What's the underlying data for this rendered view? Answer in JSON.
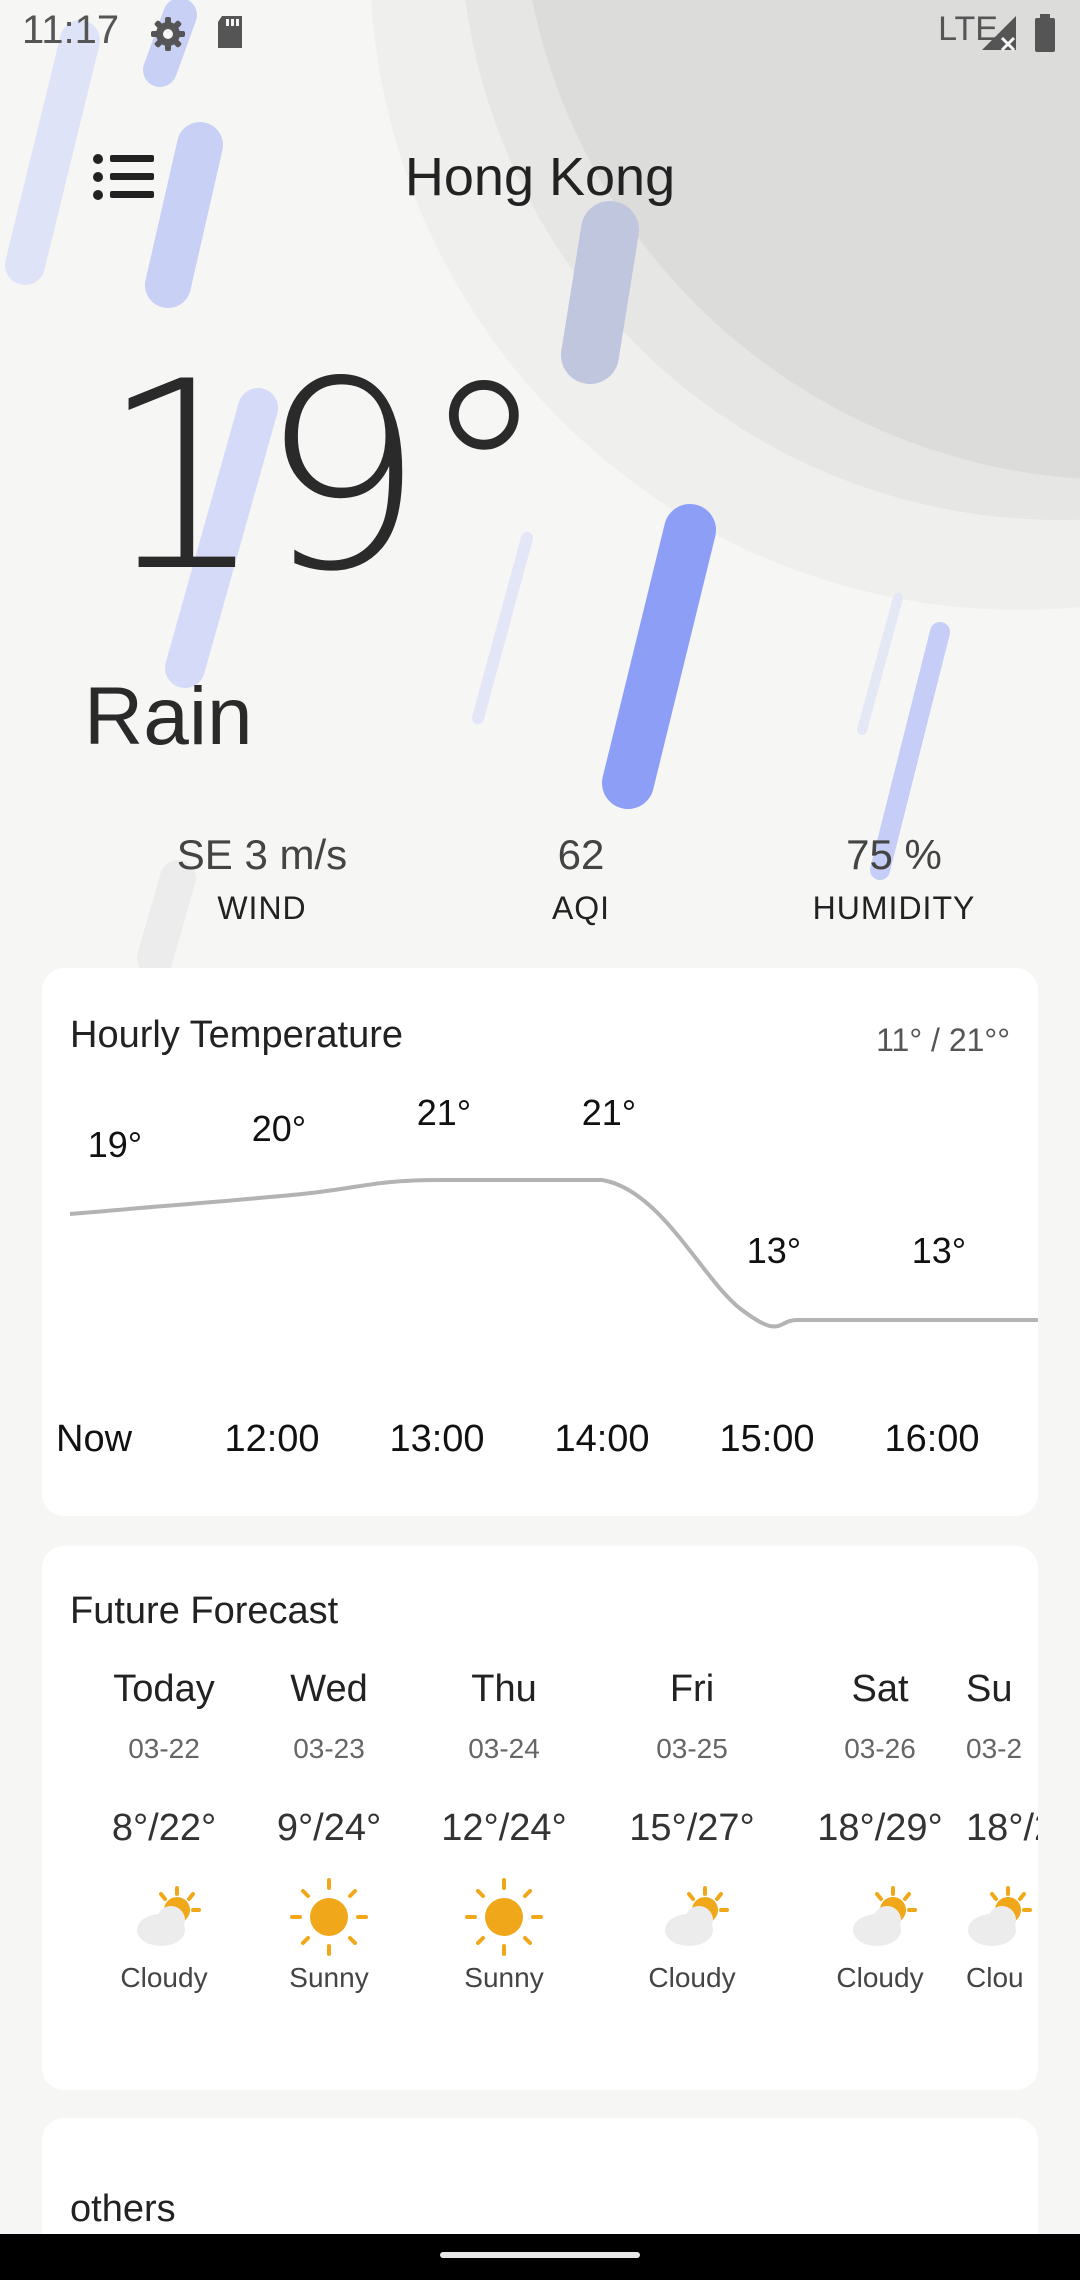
{
  "status_bar": {
    "time": "11:17",
    "network": "LTE"
  },
  "header": {
    "city": "Hong Kong"
  },
  "current": {
    "temperature": "19°",
    "condition": "Rain",
    "wind": {
      "value": "SE 3 m/s",
      "label": "WIND"
    },
    "aqi": {
      "value": "62",
      "label": "AQI"
    },
    "humidity": {
      "value": "75 %",
      "label": "HUMIDITY"
    }
  },
  "hourly": {
    "title": "Hourly Temperature",
    "range": "11° / 21°°",
    "points": [
      {
        "time": "Now",
        "temp": "19°"
      },
      {
        "time": "12:00",
        "temp": "20°"
      },
      {
        "time": "13:00",
        "temp": "21°"
      },
      {
        "time": "14:00",
        "temp": "21°"
      },
      {
        "time": "15:00",
        "temp": "13°"
      },
      {
        "time": "16:00",
        "temp": "13°"
      }
    ]
  },
  "forecast": {
    "title": "Future Forecast",
    "days": [
      {
        "name": "Today",
        "date": "03-22",
        "range": "8°/22°",
        "icon": "partly-cloudy-icon",
        "desc": "Cloudy"
      },
      {
        "name": "Wed",
        "date": "03-23",
        "range": "9°/24°",
        "icon": "sun-icon",
        "desc": "Sunny"
      },
      {
        "name": "Thu",
        "date": "03-24",
        "range": "12°/24°",
        "icon": "sun-icon",
        "desc": "Sunny"
      },
      {
        "name": "Fri",
        "date": "03-25",
        "range": "15°/27°",
        "icon": "partly-cloudy-icon",
        "desc": "Cloudy"
      },
      {
        "name": "Sat",
        "date": "03-26",
        "range": "18°/29°",
        "icon": "partly-cloudy-icon",
        "desc": "Cloudy"
      },
      {
        "name": "Su",
        "date": "03-2",
        "range": "18°/2",
        "icon": "partly-cloudy-icon",
        "desc": "Clou"
      }
    ]
  },
  "others": {
    "title": "others"
  },
  "colors": {
    "rain_dark": "#7e93f7",
    "rain_light": "#c9d0f6",
    "sun": "#f0a81a",
    "cloud": "#ececec"
  }
}
